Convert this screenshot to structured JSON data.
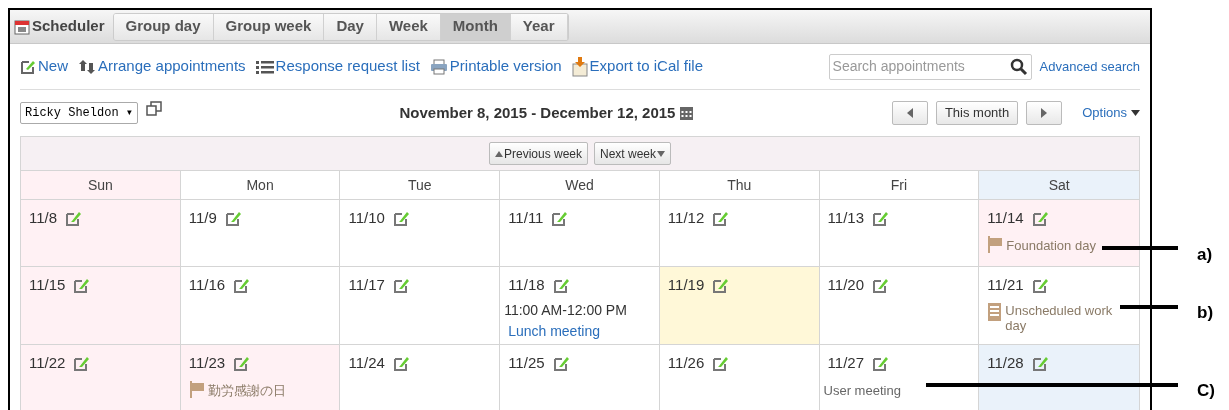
{
  "app": {
    "title": "Scheduler"
  },
  "tabs": [
    {
      "label": "Group day",
      "selected": false
    },
    {
      "label": "Group week",
      "selected": false
    },
    {
      "label": "Day",
      "selected": false
    },
    {
      "label": "Week",
      "selected": false
    },
    {
      "label": "Month",
      "selected": true
    },
    {
      "label": "Year",
      "selected": false
    }
  ],
  "toolbar": [
    {
      "kind": "new",
      "label": "New"
    },
    {
      "kind": "arrange",
      "label": "Arrange appointments"
    },
    {
      "kind": "list",
      "label": "Response request list"
    },
    {
      "kind": "print",
      "label": "Printable version"
    },
    {
      "kind": "export",
      "label": "Export to iCal file"
    }
  ],
  "search": {
    "placeholder": "Search appointments",
    "advanced": "Advanced search"
  },
  "user_select": {
    "value": "Ricky Sheldon ▾"
  },
  "range": "November 8, 2015 - December 12, 2015",
  "this_month": "This month",
  "options": "Options",
  "previous_week": "Previous week",
  "next_week": "Next week",
  "weekdays": [
    {
      "label": "Sun",
      "kind": "sunday"
    },
    {
      "label": "Mon",
      "kind": "normal"
    },
    {
      "label": "Tue",
      "kind": "normal"
    },
    {
      "label": "Wed",
      "kind": "normal"
    },
    {
      "label": "Thu",
      "kind": "normal"
    },
    {
      "label": "Fri",
      "kind": "normal"
    },
    {
      "label": "Sat",
      "kind": "saturday"
    }
  ],
  "weeks": [
    [
      {
        "date": "11/8",
        "kind": "sunday"
      },
      {
        "date": "11/9",
        "kind": "normal"
      },
      {
        "date": "11/10",
        "kind": "normal"
      },
      {
        "date": "11/11",
        "kind": "normal"
      },
      {
        "date": "11/12",
        "kind": "normal"
      },
      {
        "date": "11/13",
        "kind": "normal"
      },
      {
        "date": "11/14",
        "kind": "holiday",
        "events": [
          {
            "kind": "holiday",
            "title": "Foundation day"
          }
        ]
      }
    ],
    [
      {
        "date": "11/15",
        "kind": "sunday"
      },
      {
        "date": "11/16",
        "kind": "normal"
      },
      {
        "date": "11/17",
        "kind": "normal"
      },
      {
        "date": "11/18",
        "kind": "normal",
        "events": [
          {
            "kind": "appointment",
            "time": "11:00 AM-12:00 PM",
            "title": "Lunch meeting"
          }
        ]
      },
      {
        "date": "11/19",
        "kind": "today"
      },
      {
        "date": "11/20",
        "kind": "normal"
      },
      {
        "date": "11/21",
        "kind": "normal",
        "events": [
          {
            "kind": "workday",
            "title": "Unscheduled work day"
          }
        ]
      }
    ],
    [
      {
        "date": "11/22",
        "kind": "sunday"
      },
      {
        "date": "11/23",
        "kind": "holiday",
        "events": [
          {
            "kind": "holiday",
            "title": "勤労感謝の日"
          }
        ]
      },
      {
        "date": "11/24",
        "kind": "normal"
      },
      {
        "date": "11/25",
        "kind": "normal"
      },
      {
        "date": "11/26",
        "kind": "normal"
      },
      {
        "date": "11/27",
        "kind": "normal",
        "events": [
          {
            "kind": "note",
            "title": "User meeting"
          }
        ]
      },
      {
        "date": "11/28",
        "kind": "saturday"
      }
    ]
  ],
  "annotations": [
    {
      "label": "a)"
    },
    {
      "label": "b)"
    },
    {
      "label": "C)"
    }
  ]
}
